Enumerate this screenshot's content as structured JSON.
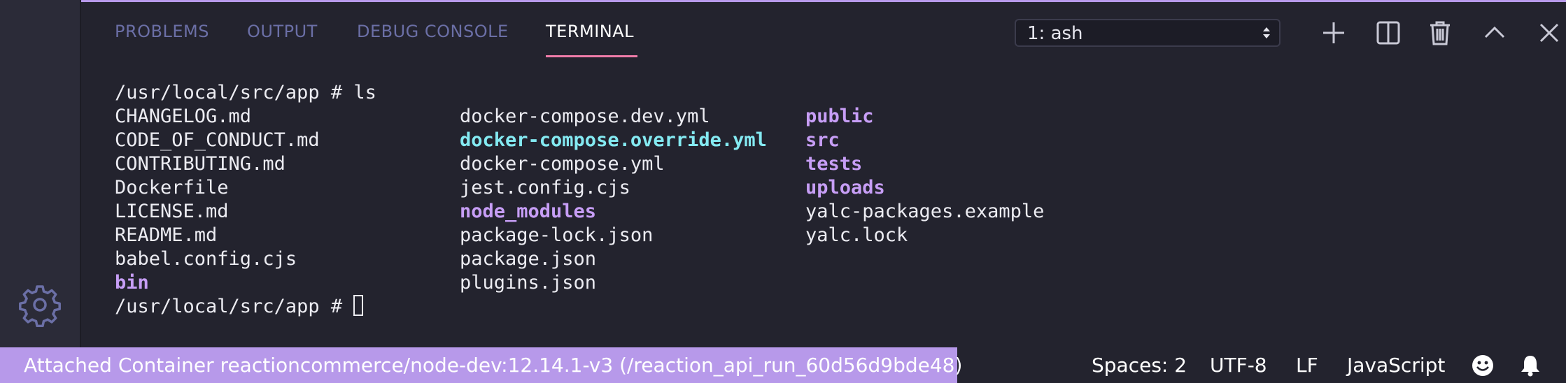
{
  "panel": {
    "tabs": [
      {
        "label": "PROBLEMS",
        "active": false
      },
      {
        "label": "OUTPUT",
        "active": false
      },
      {
        "label": "DEBUG CONSOLE",
        "active": false
      },
      {
        "label": "TERMINAL",
        "active": true
      }
    ],
    "terminal_select": {
      "value": "1: ash"
    },
    "toolbar_icons": [
      "plus-icon",
      "split-icon",
      "trash-icon",
      "chevron-up-icon",
      "close-icon"
    ]
  },
  "terminal": {
    "prompt": "/usr/local/src/app # ",
    "command": "ls",
    "columns": [
      [
        {
          "text": "CHANGELOG.md",
          "kind": "file"
        },
        {
          "text": "CODE_OF_CONDUCT.md",
          "kind": "file"
        },
        {
          "text": "CONTRIBUTING.md",
          "kind": "file"
        },
        {
          "text": "Dockerfile",
          "kind": "file"
        },
        {
          "text": "LICENSE.md",
          "kind": "file"
        },
        {
          "text": "README.md",
          "kind": "file"
        },
        {
          "text": "babel.config.cjs",
          "kind": "file"
        },
        {
          "text": "bin",
          "kind": "dir"
        }
      ],
      [
        {
          "text": "docker-compose.dev.yml",
          "kind": "file"
        },
        {
          "text": "docker-compose.override.yml",
          "kind": "symlink"
        },
        {
          "text": "docker-compose.yml",
          "kind": "file"
        },
        {
          "text": "jest.config.cjs",
          "kind": "file"
        },
        {
          "text": "node_modules",
          "kind": "dir"
        },
        {
          "text": "package-lock.json",
          "kind": "file"
        },
        {
          "text": "package.json",
          "kind": "file"
        },
        {
          "text": "plugins.json",
          "kind": "file"
        }
      ],
      [
        {
          "text": "public",
          "kind": "dir"
        },
        {
          "text": "src",
          "kind": "dir"
        },
        {
          "text": "tests",
          "kind": "dir"
        },
        {
          "text": "uploads",
          "kind": "dir"
        },
        {
          "text": "yalc-packages.example",
          "kind": "file"
        },
        {
          "text": "yalc.lock",
          "kind": "file"
        }
      ]
    ],
    "final_prompt": "/usr/local/src/app # "
  },
  "status_bar": {
    "remote_label": "Attached Container reactioncommerce/node-dev:12.14.1-v3 (/reaction_api_run_60d56d9bde48)",
    "spaces": "Spaces: 2",
    "encoding": "UTF-8",
    "eol": "LF",
    "language": "JavaScript"
  },
  "colors": {
    "accent": "#b799ea",
    "tab_underline": "#f07ca9",
    "directory": "#c79ef6",
    "symlink": "#84eaf2"
  }
}
